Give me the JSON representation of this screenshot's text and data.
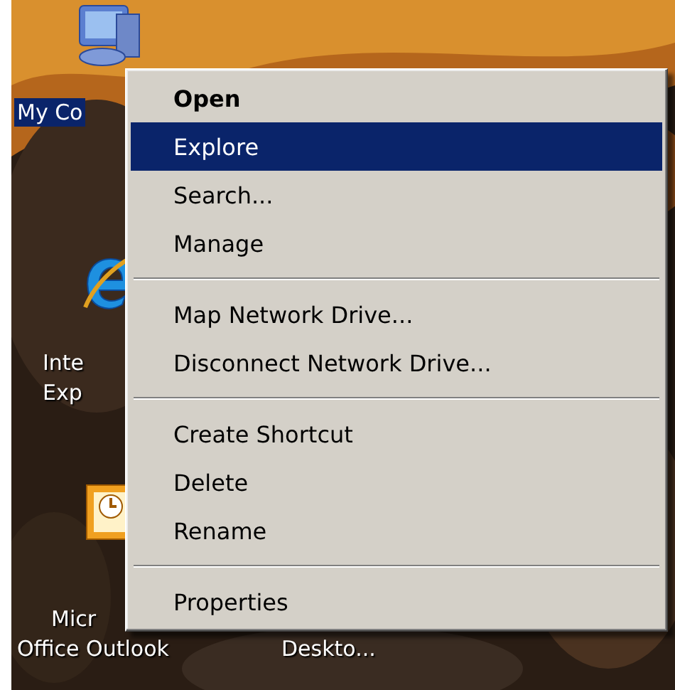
{
  "desktop_icons": [
    {
      "kind": "computer",
      "lines": [
        "My Co"
      ],
      "selected": true
    },
    {
      "kind": "browser",
      "lines": [
        "Inte",
        "Exp"
      ],
      "selected": false
    },
    {
      "kind": "mail",
      "lines": [
        "Micr",
        "Office Outlook"
      ],
      "selected": false
    },
    {
      "kind": "plain",
      "lines": [
        "Deskto..."
      ],
      "selected": false
    }
  ],
  "context_menu": [
    {
      "kind": "item",
      "label": "Open",
      "default": true,
      "selected": false
    },
    {
      "kind": "item",
      "label": "Explore",
      "default": false,
      "selected": true
    },
    {
      "kind": "item",
      "label": "Search...",
      "default": false,
      "selected": false
    },
    {
      "kind": "item",
      "label": "Manage",
      "default": false,
      "selected": false
    },
    {
      "kind": "separator"
    },
    {
      "kind": "item",
      "label": "Map Network Drive...",
      "default": false,
      "selected": false
    },
    {
      "kind": "item",
      "label": "Disconnect Network Drive...",
      "default": false,
      "selected": false
    },
    {
      "kind": "separator"
    },
    {
      "kind": "item",
      "label": "Create Shortcut",
      "default": false,
      "selected": false
    },
    {
      "kind": "item",
      "label": "Delete",
      "default": false,
      "selected": false
    },
    {
      "kind": "item",
      "label": "Rename",
      "default": false,
      "selected": false
    },
    {
      "kind": "separator"
    },
    {
      "kind": "item",
      "label": "Properties",
      "default": false,
      "selected": false
    }
  ]
}
